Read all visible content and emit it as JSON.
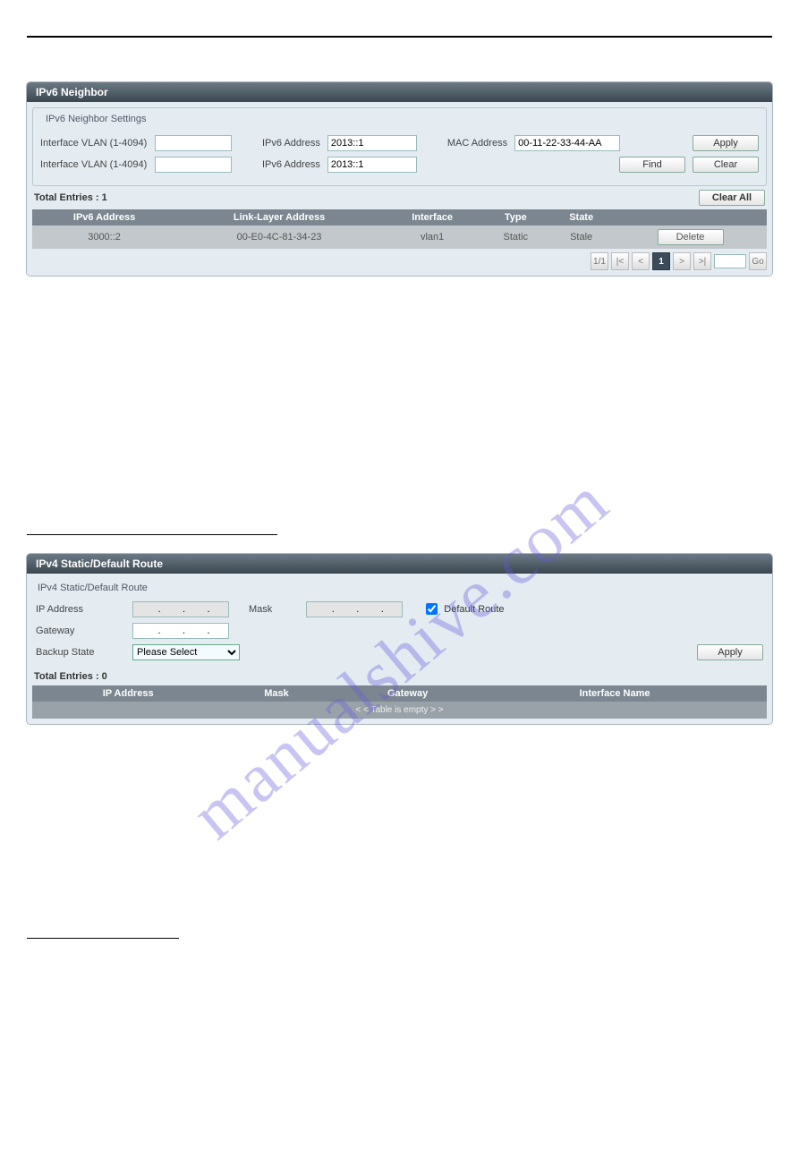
{
  "watermark": "manualshive.com",
  "panel1": {
    "title": "IPv6 Neighbor",
    "fieldset_title": "IPv6 Neighbor Settings",
    "row1": {
      "vlan_label": "Interface VLAN (1-4094)",
      "vlan_value": "",
      "ipv6_label": "IPv6 Address",
      "ipv6_value": "2013::1",
      "mac_label": "MAC Address",
      "mac_value": "00-11-22-33-44-AA",
      "apply": "Apply"
    },
    "row2": {
      "vlan_label": "Interface VLAN (1-4094)",
      "vlan_value": "",
      "ipv6_label": "IPv6 Address",
      "ipv6_value": "2013::1",
      "find": "Find",
      "clear": "Clear"
    },
    "total_label": "Total Entries : 1",
    "clear_all": "Clear All",
    "headers": [
      "IPv6 Address",
      "Link-Layer Address",
      "Interface",
      "Type",
      "State",
      ""
    ],
    "rows": [
      {
        "ipv6": "3000::2",
        "ll": "00-E0-4C-81-34-23",
        "if": "vlan1",
        "type": "Static",
        "state": "Stale",
        "delete": "Delete"
      }
    ],
    "paginate": {
      "info": "1/1",
      "first": "|<",
      "prev": "<",
      "current": "1",
      "next": ">",
      "last": ">|",
      "go": "Go",
      "goval": ""
    }
  },
  "panel2": {
    "title": "IPv4 Static/Default Route",
    "fieldset_title": "IPv4 Static/Default Route",
    "fields": {
      "ip_label": "IP Address",
      "ip_value": "",
      "ip_hint": "        .        .        .        ",
      "mask_label": "Mask",
      "mask_value": "",
      "mask_hint": "        .        .        .        ",
      "default_route": "Default Route",
      "gateway_label": "Gateway",
      "gateway_value": "",
      "gateway_hint": "        .        .        .        ",
      "backup_label": "Backup State",
      "backup_value": "Please Select",
      "apply": "Apply"
    },
    "total_label": "Total Entries : 0",
    "headers": [
      "IP Address",
      "Mask",
      "Gateway",
      "Interface Name",
      ""
    ],
    "empty": "< < Table is empty > >"
  }
}
